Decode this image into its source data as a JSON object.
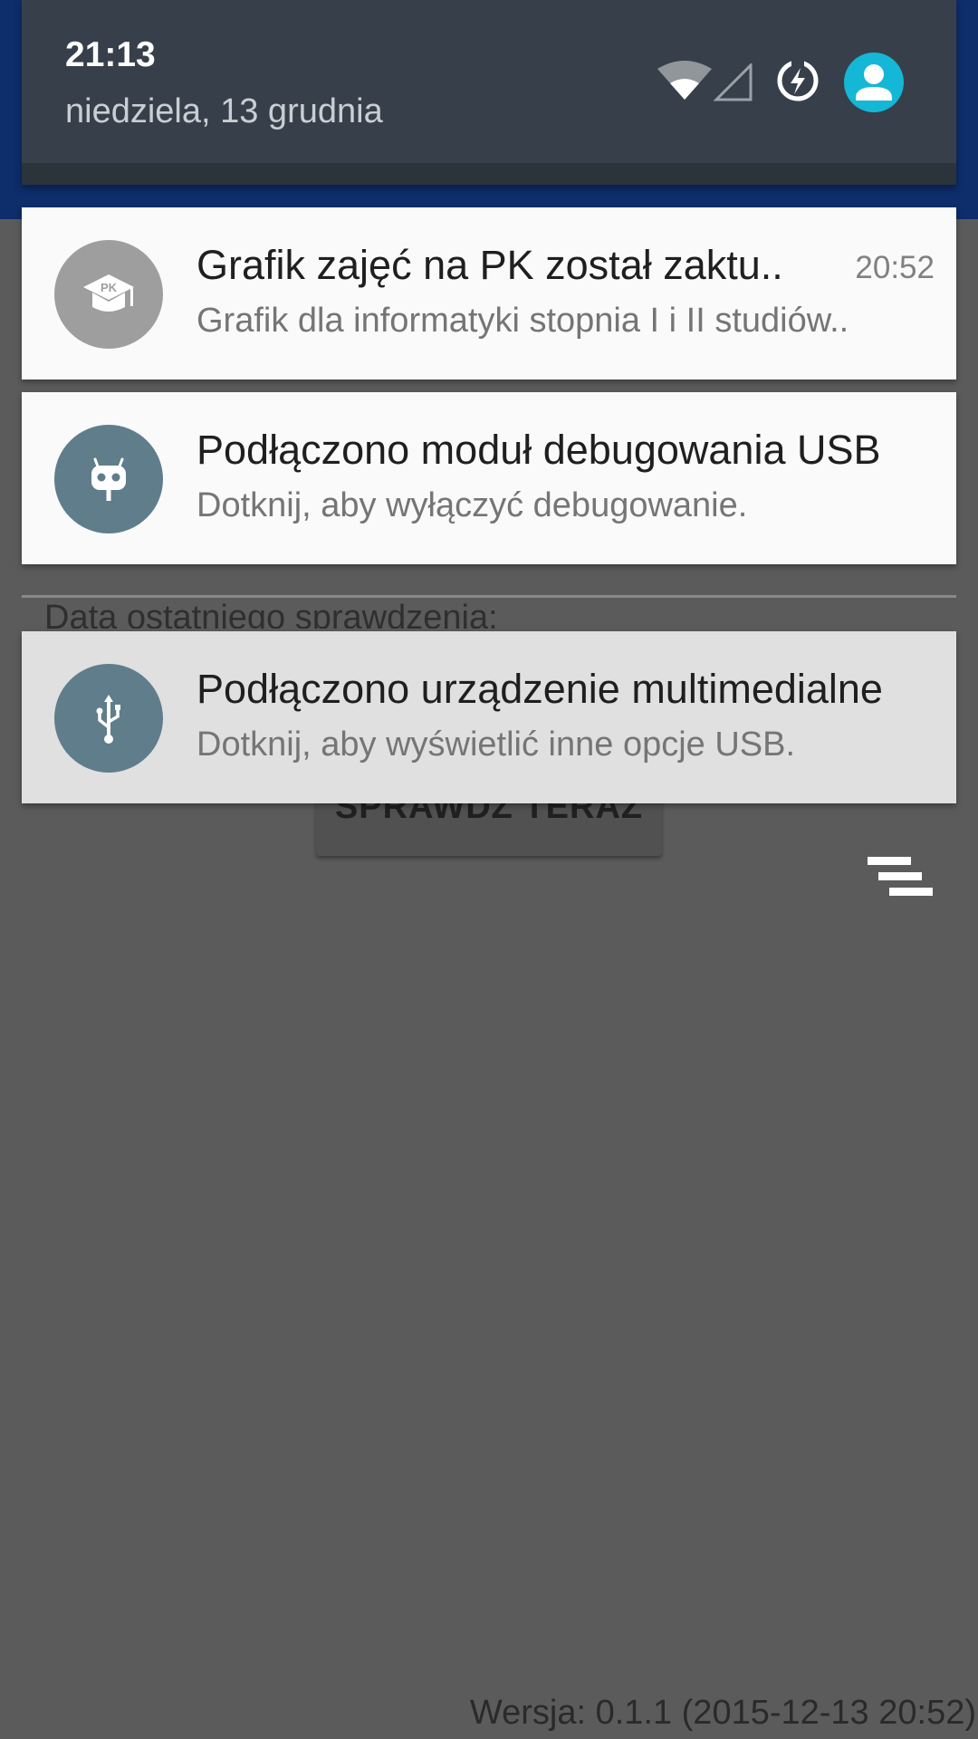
{
  "app": {
    "last_check_label": "Data ostatniego sprawdzenia:",
    "check_button_label": "SPRAWDŹ TERAZ",
    "version_label": "Wersja: 0.1.1 (2015-12-13 20:52)"
  },
  "header": {
    "clock": "21:13",
    "date": "niedziela, 13 grudnia",
    "icons": [
      "wifi-icon",
      "signal-icon",
      "power-saver-icon",
      "user-avatar-icon"
    ]
  },
  "notifications": [
    {
      "title": "Grafik zajęć na PK został zaktu..",
      "text": "Grafik dla informatyki stopnia I i II studiów..",
      "time": "20:52",
      "icon": "pk-graduation-cap-icon",
      "icon_text": "PK",
      "icon_color": "#9e9e9e"
    },
    {
      "title": "Podłączono moduł debugowania USB",
      "text": "Dotknij, aby wyłączyć debugowanie.",
      "icon": "android-debug-icon",
      "icon_color": "#607d8b"
    },
    {
      "title": "Podłączono urządzenie multimedialne",
      "text": "Dotknij, aby wyświetlić inne opcje USB.",
      "icon": "usb-icon",
      "icon_color": "#607d8b"
    }
  ],
  "colors": {
    "header_bg": "#37404a",
    "avatar": "#14b7d6",
    "scrim": "#5b5b5b",
    "app_toolbar": "#0d2d6b"
  }
}
